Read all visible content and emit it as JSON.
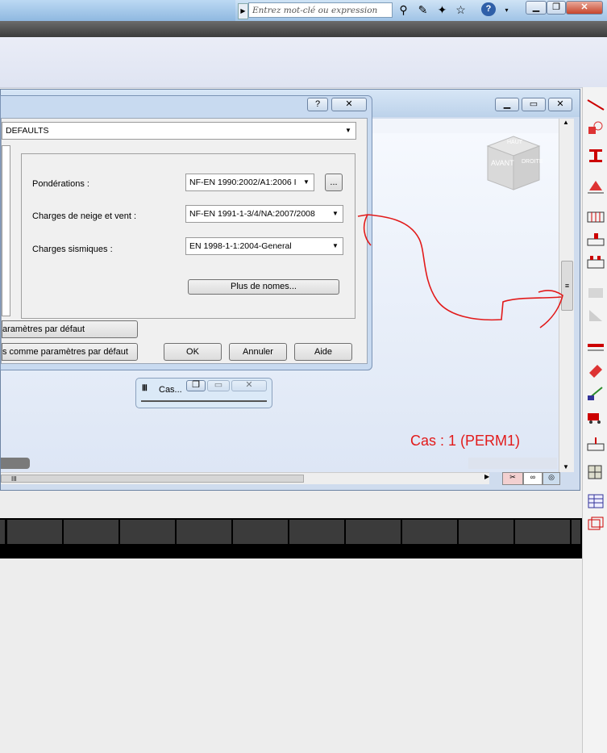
{
  "toolbar": {
    "search_placeholder": "Entrez mot-clé ou expression",
    "icons": [
      "binoculars-icon",
      "wrench-icon",
      "satellite-icon",
      "star-icon",
      "help-icon"
    ],
    "help_label": "?"
  },
  "dialog": {
    "help_btn": "?",
    "close_btn": "☒",
    "top_combo_value": "DEFAULTS",
    "rows": [
      {
        "label": "Pondérations :",
        "value": "NF-EN 1990:2002/A1:2006 I"
      },
      {
        "label": "Charges de neige et vent :",
        "value": "NF-EN 1991-1-3/4/NA:2007/2008"
      },
      {
        "label": "Charges sismiques :",
        "value": "EN 1998-1-1:2004-General"
      }
    ],
    "browse_btn": "...",
    "more_btn": "Plus de nomes...",
    "defaults_btn": "aramètres par défaut",
    "save_defaults_btn": "s comme paramètres par défaut",
    "ok": "OK",
    "cancel": "Annuler",
    "help": "Aide"
  },
  "view": {
    "cube_front": "AVANT",
    "cube_right": "DROITE",
    "cube_top": "HAUT",
    "case_label": "Cas : 1 (PERM1)",
    "hscroll_grip": "III"
  },
  "caswin": {
    "title": "Cas..."
  },
  "colors": {
    "annotation": "#e21a1a"
  }
}
